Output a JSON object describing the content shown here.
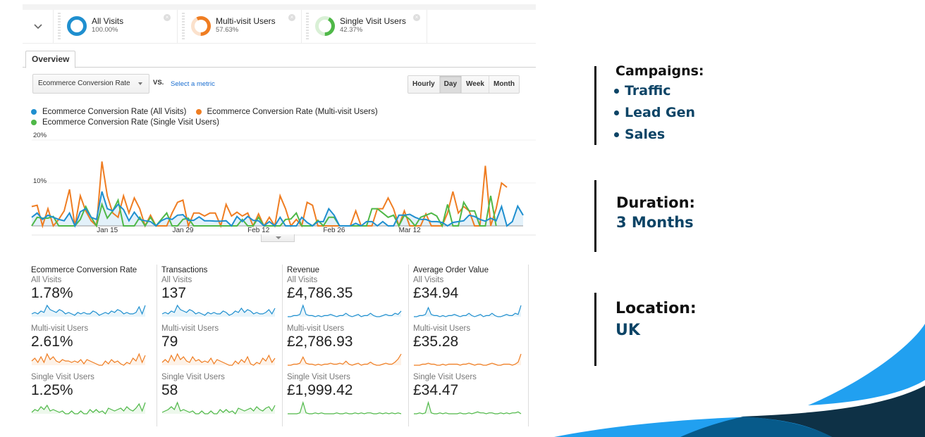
{
  "segments": {
    "toggle_icon": "chevron-down-icon",
    "items": [
      {
        "name": "All Visits",
        "percent": "100.00%",
        "fraction": 1.0,
        "color": "#1f8fcf",
        "track": "#d7ebf7"
      },
      {
        "name": "Multi-visit Users",
        "percent": "57.63%",
        "fraction": 0.5763,
        "color": "#ef7d22",
        "track": "#fbe1cc"
      },
      {
        "name": "Single Visit Users",
        "percent": "42.37%",
        "fraction": 0.4237,
        "color": "#4fb848",
        "track": "#d9f0d6"
      }
    ],
    "close_icon": "close-circle-icon"
  },
  "tabs": [
    {
      "label": "Overview",
      "active": true
    }
  ],
  "controls": {
    "metric": "Ecommerce Conversion Rate",
    "vs_label": "VS.",
    "compare_link": "Select a metric",
    "time_buttons": [
      {
        "label": "Hourly",
        "active": false
      },
      {
        "label": "Day",
        "active": true
      },
      {
        "label": "Week",
        "active": false
      },
      {
        "label": "Month",
        "active": false
      }
    ]
  },
  "chart_data": {
    "type": "line",
    "title": "",
    "xlabel": "",
    "ylabel": "",
    "ylim": [
      0,
      20
    ],
    "yticks": [
      "20%",
      "10%"
    ],
    "ytick_values": [
      20,
      10
    ],
    "xticks": [
      "Jan 15",
      "Jan 29",
      "Feb 12",
      "Feb 26",
      "Mar 12"
    ],
    "xtick_index": [
      14,
      28,
      42,
      56,
      70
    ],
    "grid": true,
    "legend_position": "top-left",
    "x": "daily, Jan 1 – Mar 26 (86 days)",
    "series": [
      {
        "name": "Ecommerce Conversion Rate (All Visits)",
        "color": "#1f8fcf",
        "fill": true,
        "values": [
          2.0,
          3.0,
          1.5,
          2.5,
          2.0,
          1.5,
          1.2,
          3.0,
          0.0,
          3.3,
          4.0,
          2.0,
          1.5,
          8.0,
          4.0,
          3.5,
          5.0,
          3.8,
          1.2,
          3.2,
          1.5,
          1.2,
          1.0,
          0.0,
          1.2,
          1.8,
          1.5,
          2.5,
          2.6,
          1.3,
          1.3,
          2.1,
          1.2,
          1.2,
          1.1,
          1.1,
          1.2,
          0.0,
          2.2,
          1.0,
          2.2,
          1.3,
          1.2,
          0.0,
          1.0,
          0.0,
          2.0,
          0.0,
          0.0,
          0.0,
          2.0,
          0.8,
          0.0,
          1.0,
          1.0,
          4.0,
          2.5,
          0.0,
          0.0,
          0.0,
          0.6,
          0.0,
          1.0,
          1.0,
          0.0,
          1.0,
          0.0,
          0.0,
          2.5,
          2.5,
          2.7,
          2.0,
          1.5,
          1.5,
          1.0,
          1.0,
          0.8,
          0.0,
          0.8,
          1.0,
          1.2,
          2.5,
          2.2,
          1.5,
          1.1,
          1.8,
          1.2,
          4.5,
          0.0,
          1.0,
          4.6,
          2.5
        ]
      },
      {
        "name": "Ecommerce Conversion Rate (Multi-visit Users)",
        "color": "#ef7d22",
        "fill": false,
        "values": [
          4.5,
          4.8,
          0.0,
          4.0,
          0.0,
          1.5,
          3.5,
          8.5,
          0.0,
          7.0,
          3.5,
          1.2,
          0.0,
          15.0,
          7.0,
          3.0,
          2.0,
          7.0,
          3.0,
          6.5,
          4.0,
          0.0,
          2.5,
          0.0,
          0.0,
          0.0,
          3.0,
          5.5,
          6.0,
          0.0,
          3.0,
          3.0,
          2.3,
          3.0,
          3.0,
          0.0,
          5.0,
          2.3,
          3.2,
          2.3,
          3.0,
          0.0,
          2.8,
          0.0,
          2.0,
          0.0,
          7.0,
          4.0,
          0.0,
          1.5,
          0.0,
          5.5,
          4.8,
          0.0,
          0.0,
          0.0,
          0.0,
          0.0,
          0.0,
          0.0,
          3.5,
          0.0,
          0.0,
          0.0,
          4.0,
          4.0,
          6.5,
          4.0,
          0.0,
          3.5,
          0.0,
          0.0,
          0.0,
          2.8,
          0.0,
          0.0,
          0.0,
          3.0,
          8.0,
          3.0,
          4.5,
          3.5,
          0.0,
          0.0,
          14.0,
          0.0,
          4.0,
          10.0,
          9.0
        ]
      },
      {
        "name": "Ecommerce Conversion Rate (Single Visit Users)",
        "color": "#4fb848",
        "fill": false,
        "values": [
          0.0,
          2.0,
          1.8,
          1.8,
          2.2,
          0.0,
          0.0,
          0.0,
          0.0,
          1.5,
          4.5,
          2.0,
          0.0,
          5.0,
          1.8,
          3.5,
          6.0,
          0.0,
          0.0,
          0.0,
          2.0,
          0.0,
          2.0,
          0.0,
          1.5,
          3.0,
          0.0,
          0.0,
          1.5,
          1.8,
          0.0,
          0.0,
          0.0,
          0.0,
          0.0,
          0.0,
          0.0,
          0.0,
          0.0,
          1.5,
          0.0,
          0.0,
          2.0,
          0.0,
          0.0,
          0.0,
          0.0,
          1.5,
          1.6,
          3.0,
          0.0,
          0.0,
          0.0,
          1.3,
          0.0,
          2.0,
          2.0,
          0.0,
          0.0,
          0.0,
          0.0,
          0.0,
          0.0,
          4.0,
          4.0,
          3.0,
          2.0,
          2.5,
          0.0,
          2.5,
          1.5,
          0.0,
          2.0,
          2.5,
          3.0,
          2.3,
          0.0,
          5.0,
          0.0,
          0.0,
          5.5,
          3.5,
          3.5,
          0.0,
          0.0,
          7.0,
          0.0
        ]
      }
    ]
  },
  "scorecards": [
    {
      "title": "Ecommerce Conversion Rate",
      "groups": [
        {
          "label": "All Visits",
          "value": "1.78%",
          "color": "#1f8fcf",
          "spark": [
            2,
            3,
            2,
            4,
            3,
            8,
            5,
            4,
            3,
            5,
            4,
            2,
            3,
            2,
            1,
            3,
            2,
            3,
            2,
            2,
            4,
            3,
            1,
            2,
            3,
            2,
            4,
            3,
            5,
            4,
            2,
            3,
            2,
            2,
            3,
            7,
            2,
            8
          ]
        },
        {
          "label": "Multi-visit Users",
          "value": "2.61%",
          "color": "#ef7d22",
          "spark": [
            3,
            5,
            2,
            6,
            2,
            8,
            4,
            6,
            3,
            2,
            4,
            3,
            3,
            2,
            3,
            2,
            4,
            1,
            4,
            3,
            2,
            1,
            0,
            0,
            3,
            1,
            4,
            2,
            3,
            1,
            0,
            2,
            1,
            5,
            3,
            8,
            2,
            7
          ]
        },
        {
          "label": "Single Visit Users",
          "value": "1.25%",
          "color": "#4fb848",
          "spark": [
            1,
            3,
            2,
            5,
            3,
            6,
            2,
            3,
            2,
            1,
            2,
            0,
            0,
            2,
            0,
            0,
            2,
            0,
            0,
            3,
            1,
            3,
            1,
            2,
            0,
            4,
            3,
            2,
            3,
            4,
            2,
            5,
            3,
            2,
            4,
            7,
            2,
            8
          ]
        }
      ]
    },
    {
      "title": "Transactions",
      "groups": [
        {
          "label": "All Visits",
          "value": "137",
          "color": "#1f8fcf",
          "spark": [
            2,
            3,
            2,
            4,
            3,
            8,
            5,
            4,
            3,
            5,
            4,
            2,
            3,
            2,
            1,
            3,
            2,
            3,
            2,
            2,
            4,
            3,
            1,
            2,
            4,
            3,
            6,
            3,
            5,
            4,
            2,
            3,
            2,
            2,
            3,
            5,
            2,
            6
          ]
        },
        {
          "label": "Multi-visit Users",
          "value": "79",
          "color": "#ef7d22",
          "spark": [
            2,
            4,
            2,
            7,
            3,
            8,
            4,
            6,
            3,
            2,
            6,
            3,
            4,
            2,
            3,
            2,
            5,
            1,
            4,
            3,
            2,
            1,
            0,
            0,
            3,
            1,
            4,
            2,
            6,
            1,
            0,
            2,
            1,
            5,
            3,
            7,
            2,
            5
          ]
        },
        {
          "label": "Single Visit Users",
          "value": "58",
          "color": "#4fb848",
          "spark": [
            1,
            2,
            3,
            5,
            3,
            8,
            2,
            3,
            2,
            1,
            2,
            0,
            0,
            2,
            0,
            0,
            2,
            0,
            0,
            3,
            1,
            3,
            1,
            2,
            0,
            4,
            3,
            2,
            3,
            4,
            2,
            5,
            3,
            2,
            4,
            5,
            2,
            6
          ]
        }
      ]
    },
    {
      "title": "Revenue",
      "groups": [
        {
          "label": "All Visits",
          "value": "£4,786.35",
          "color": "#1f8fcf",
          "spark": [
            0,
            0,
            1,
            1,
            2,
            10,
            2,
            1,
            1,
            0,
            1,
            0,
            1,
            1,
            2,
            1,
            0,
            1,
            1,
            3,
            1,
            0,
            1,
            2,
            0,
            1,
            1,
            3,
            1,
            0,
            0,
            1,
            2,
            1,
            1,
            3,
            2,
            5
          ]
        },
        {
          "label": "Multi-visit Users",
          "value": "£2,786.93",
          "color": "#ef7d22",
          "spark": [
            0,
            0,
            1,
            1,
            2,
            8,
            2,
            1,
            1,
            0,
            1,
            0,
            1,
            1,
            2,
            1,
            1,
            2,
            1,
            4,
            1,
            0,
            1,
            2,
            0,
            1,
            1,
            3,
            1,
            0,
            0,
            1,
            2,
            1,
            1,
            3,
            6,
            11
          ]
        },
        {
          "label": "Single Visit Users",
          "value": "£1,999.42",
          "color": "#4fb848",
          "spark": [
            0,
            0,
            0,
            0,
            1,
            12,
            1,
            0,
            0,
            1,
            0,
            1,
            0,
            0,
            0,
            0,
            1,
            0,
            0,
            1,
            0,
            0,
            1,
            0,
            1,
            0,
            1,
            1,
            0,
            0,
            1,
            0,
            1,
            0,
            1,
            0,
            1,
            0
          ]
        }
      ]
    },
    {
      "title": "Average Order Value",
      "groups": [
        {
          "label": "All Visits",
          "value": "£34.94",
          "color": "#1f8fcf",
          "spark": [
            0,
            0,
            1,
            1,
            2,
            8,
            2,
            1,
            1,
            0,
            1,
            0,
            1,
            1,
            2,
            1,
            0,
            1,
            1,
            3,
            1,
            0,
            1,
            2,
            0,
            1,
            1,
            3,
            1,
            0,
            0,
            1,
            2,
            1,
            1,
            3,
            2,
            10
          ]
        },
        {
          "label": "Multi-visit Users",
          "value": "£35.28",
          "color": "#ef7d22",
          "spark": [
            0,
            0,
            0,
            1,
            1,
            2,
            1,
            1,
            0,
            0,
            1,
            0,
            1,
            1,
            1,
            1,
            0,
            1,
            1,
            2,
            1,
            0,
            1,
            1,
            0,
            0,
            1,
            2,
            1,
            0,
            0,
            1,
            1,
            1,
            0,
            1,
            3,
            11
          ]
        },
        {
          "label": "Single Visit Users",
          "value": "£34.47",
          "color": "#4fb848",
          "spark": [
            0,
            0,
            1,
            0,
            1,
            12,
            1,
            0,
            0,
            1,
            0,
            1,
            0,
            0,
            0,
            0,
            1,
            0,
            0,
            1,
            0,
            1,
            2,
            1,
            1,
            0,
            1,
            1,
            0,
            0,
            1,
            0,
            1,
            0,
            1,
            1,
            2,
            0
          ]
        }
      ]
    }
  ],
  "info": {
    "campaigns_title": "Campaigns:",
    "campaigns": [
      "Traffic",
      "Lead Gen",
      "Sales"
    ],
    "duration_title": "Duration:",
    "duration_value": "3 Months",
    "location_title": "Location:",
    "location_value": "UK",
    "accent_color": "#0d4466"
  },
  "decor": {
    "wave_colors": [
      "#21a0f0",
      "#075a8a",
      "#0e3146"
    ]
  }
}
